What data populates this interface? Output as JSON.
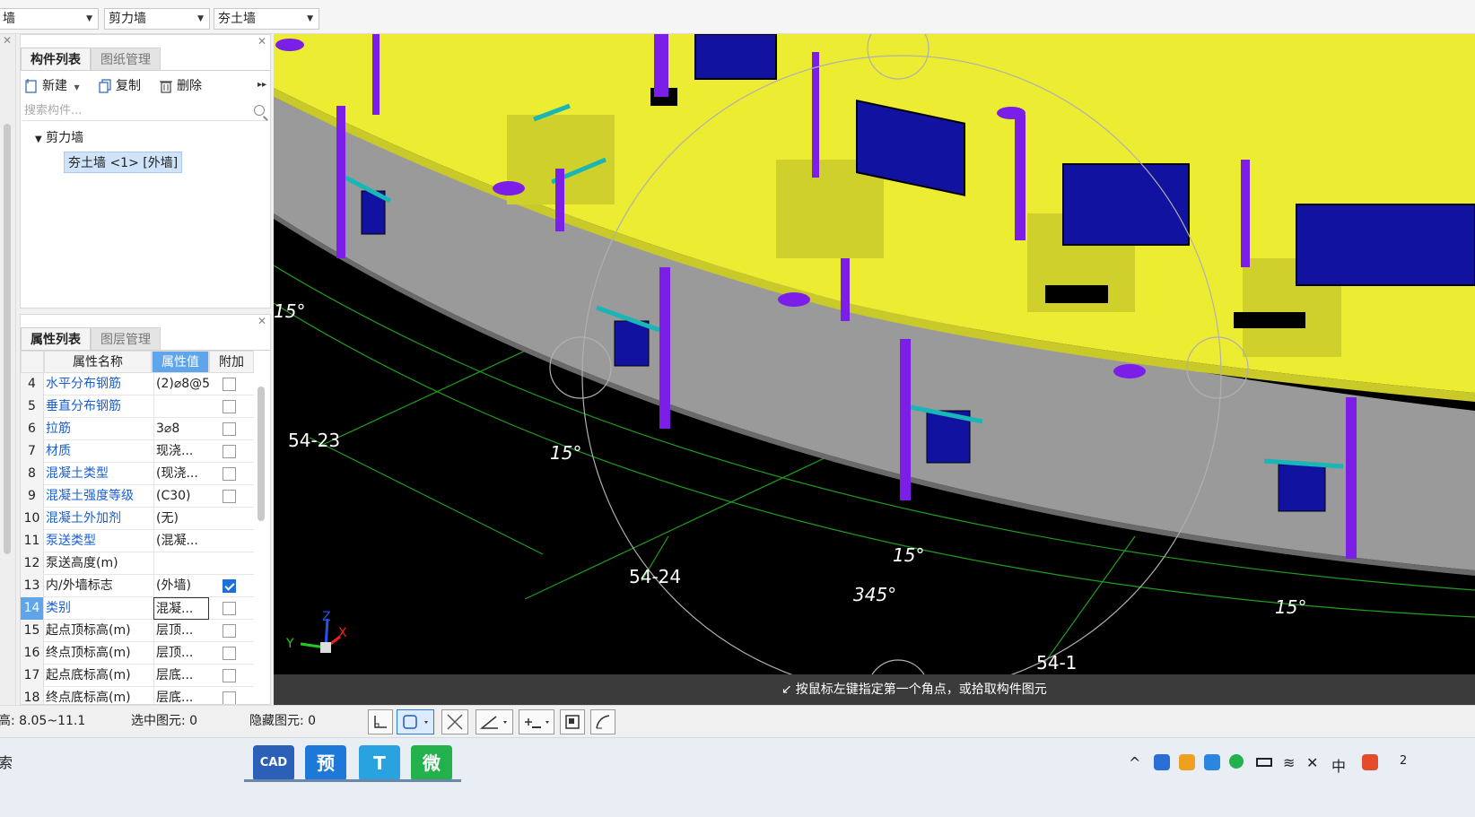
{
  "toolbar": {
    "combo1": "墙",
    "combo2": "剪力墙",
    "combo3": "夯土墙"
  },
  "component_panel": {
    "tabs": [
      "构件列表",
      "图纸管理"
    ],
    "actions": {
      "new": "新建",
      "copy": "复制",
      "delete": "删除"
    },
    "search_placeholder": "搜索构件...",
    "tree_root": "剪力墙",
    "tree_item": "夯土墙 <1> [外墙]"
  },
  "property_panel": {
    "tabs": [
      "属性列表",
      "图层管理"
    ],
    "headers": {
      "name": "属性名称",
      "value": "属性值",
      "extra": "附加"
    },
    "rows": [
      {
        "num": "4",
        "name": "水平分布钢筋",
        "value": "(2)⌀8@5",
        "check": false,
        "blue": true
      },
      {
        "num": "5",
        "name": "垂直分布钢筋",
        "value": "",
        "check": false,
        "blue": true
      },
      {
        "num": "6",
        "name": "拉筋",
        "value": "3⌀8",
        "check": false,
        "blue": true
      },
      {
        "num": "7",
        "name": "材质",
        "value": "现浇...",
        "check": false,
        "blue": true
      },
      {
        "num": "8",
        "name": "混凝土类型",
        "value": "(现浇...",
        "check": false,
        "blue": true
      },
      {
        "num": "9",
        "name": "混凝土强度等级",
        "value": "(C30)",
        "check": false,
        "blue": true
      },
      {
        "num": "10",
        "name": "混凝土外加剂",
        "value": "(无)",
        "check": null,
        "blue": true
      },
      {
        "num": "11",
        "name": "泵送类型",
        "value": "(混凝...",
        "check": null,
        "blue": true
      },
      {
        "num": "12",
        "name": "泵送高度(m)",
        "value": "",
        "check": null,
        "blue": false
      },
      {
        "num": "13",
        "name": "内/外墙标志",
        "value": "(外墙)",
        "check": true,
        "blue": false
      },
      {
        "num": "14",
        "name": "类别",
        "value": "混凝...",
        "check": false,
        "blue": true
      },
      {
        "num": "15",
        "name": "起点顶标高(m)",
        "value": "层顶...",
        "check": false,
        "blue": false
      },
      {
        "num": "16",
        "name": "终点顶标高(m)",
        "value": "层顶...",
        "check": false,
        "blue": false
      },
      {
        "num": "17",
        "name": "起点底标高(m)",
        "value": "层底...",
        "check": false,
        "blue": false
      },
      {
        "num": "18",
        "name": "终点底标高(m)",
        "value": "层底...",
        "check": false,
        "blue": false
      }
    ]
  },
  "viewport": {
    "labels": {
      "angle_a": "15°",
      "angle_b": "15°",
      "angle_c": "15°",
      "angle_d": "345°",
      "angle_e": "15°",
      "axis_a": "54-23",
      "axis_b": "54-24",
      "axis_c": "54-1"
    },
    "axes": {
      "x": "X",
      "y": "Y",
      "z": "Z"
    },
    "colors": {
      "wall_top": "#ecec32",
      "wall_gray": "#9a9a9a",
      "column": "#7b1fe8",
      "window": "#1212a0",
      "grid": "#1f9e1f"
    },
    "hint": "按鼠标左键指定第一个角点，或拾取构件图元"
  },
  "status": {
    "height": "高:  8.05~11.1",
    "selected": "选中图元: 0",
    "hidden": "隐藏图元: 0"
  },
  "taskbar": {
    "search": "索",
    "apps": [
      {
        "label": "CAD",
        "color": "#2b5fb8"
      },
      {
        "label": "预",
        "color": "#1e78d8"
      },
      {
        "label": "T",
        "color": "#29a3e0"
      },
      {
        "label": "微",
        "color": "#22b14c"
      }
    ],
    "tray_ime": "中",
    "tray_clock": "2"
  }
}
